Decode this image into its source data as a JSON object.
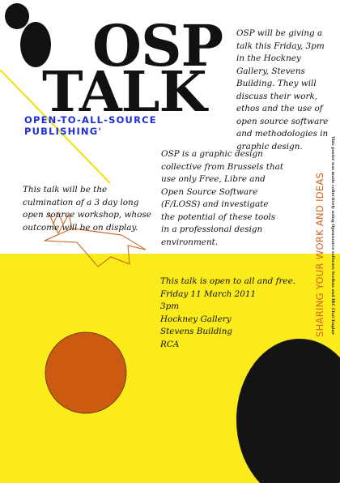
{
  "poster": {
    "title_line_1": "OSP",
    "title_line_2": "TALK",
    "subtitle": "OPEN-TO-ALL-SOURCE PUBLISHING'",
    "intro": "OSP will be giving a talk this Friday, 3pm in the Hockney Gallery, Stevens Building. They will discuss their work, ethos and the use of open source software and methodologies in graphic design.",
    "about": "OSP is a graphic design collective from Brussels that use only Free, Libre and Open Source Software (F/LOSS) and investigate the potential of these tools in a professional design environment.",
    "workshop": "This talk will be the culmination of a 3 day long open source workshop, whose outcome will be on display.",
    "details": {
      "line_1": "This talk is open to all and free.",
      "line_2": "Friday 11 March 2011",
      "line_3": "3pm",
      "line_4": "Hockney Gallery",
      "line_5": "Stevens Building",
      "line_6": "RCA"
    },
    "vertical_tagline": "SHARING YOUR WORK AND IDEAS",
    "vertical_credit": "This poster was made collectively using Opensource software Scribus and IRC Chat Engine"
  },
  "colors": {
    "yellow": "#fbeb1b",
    "black": "#111111",
    "blue": "#1d2fd6",
    "orange": "#cc5a10",
    "orange_text": "#d5611a"
  }
}
